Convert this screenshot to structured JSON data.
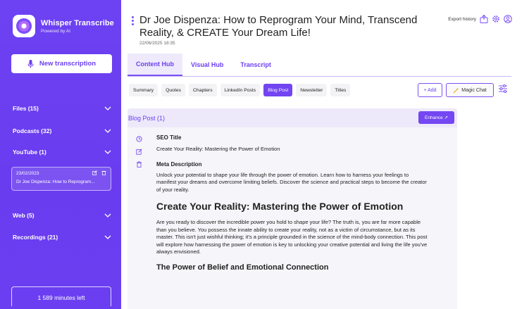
{
  "app": {
    "title": "Whisper Transcribe",
    "subtitle": "Powered by AI"
  },
  "sidebar": {
    "new_transcription": "New transcription",
    "sections": [
      {
        "label": "Files (15)"
      },
      {
        "label": "Podcasts (32)"
      },
      {
        "label": "YouTube (1)"
      },
      {
        "label": "Web (5)"
      },
      {
        "label": "Recordings (21)"
      }
    ],
    "youtube_item": {
      "date": "23/02/2023",
      "title": "Dr Joe Dispenza: How to Reprogram..."
    },
    "minutes_left": "1 589 minutes left"
  },
  "header": {
    "title": "Dr Joe Dispenza: How to Reprogram Your Mind, Transcend Reality, & CREATE Your Dream Life!",
    "date": "22/06/2025 18:35",
    "export_history": "Export history"
  },
  "tabs": [
    {
      "label": "Content Hub",
      "active": true
    },
    {
      "label": "Visual Hub",
      "active": false
    },
    {
      "label": "Transcript",
      "active": false
    }
  ],
  "subtabs": [
    {
      "label": "Summary",
      "active": false
    },
    {
      "label": "Quotes",
      "active": false
    },
    {
      "label": "Chapters",
      "active": false
    },
    {
      "label": "LinkedIn Posts",
      "active": false
    },
    {
      "label": "Blog Post",
      "active": true
    },
    {
      "label": "Newsletter",
      "active": false
    },
    {
      "label": "Titles",
      "active": false
    }
  ],
  "actions": {
    "add": "+ Add",
    "magic_chat": "Magic Chat"
  },
  "panel": {
    "title": "Blog Post (1)",
    "enhance": "Enhance ↗",
    "seo_title_label": "SEO Title",
    "seo_title": "Create Your Reality: Mastering the Power of Emotion",
    "meta_label": "Meta Description",
    "meta": "Unlock your potential to shape your life through the power of emotion. Learn how to harness your feelings to manifest your dreams and overcome limiting beliefs. Discover the science and practical steps to become the creator of your reality.",
    "h1": "Create Your Reality: Mastering the Power of Emotion",
    "intro": "Are you ready to discover the incredible power you hold to shape your life? The truth is, you are far more capable than you believe. You possess the innate ability to create your reality, not as a victim of circumstance, but as its master. This isn't just wishful thinking; it's a principle grounded in the science of the mind-body connection. This post will explore how harnessing the power of emotion is key to unlocking your creative potential and living the life you've always envisioned.",
    "h2": "The Power of Belief and Emotional Connection"
  },
  "colors": {
    "accent": "#6b3ff1",
    "sidebar": "#6c3ff0"
  }
}
